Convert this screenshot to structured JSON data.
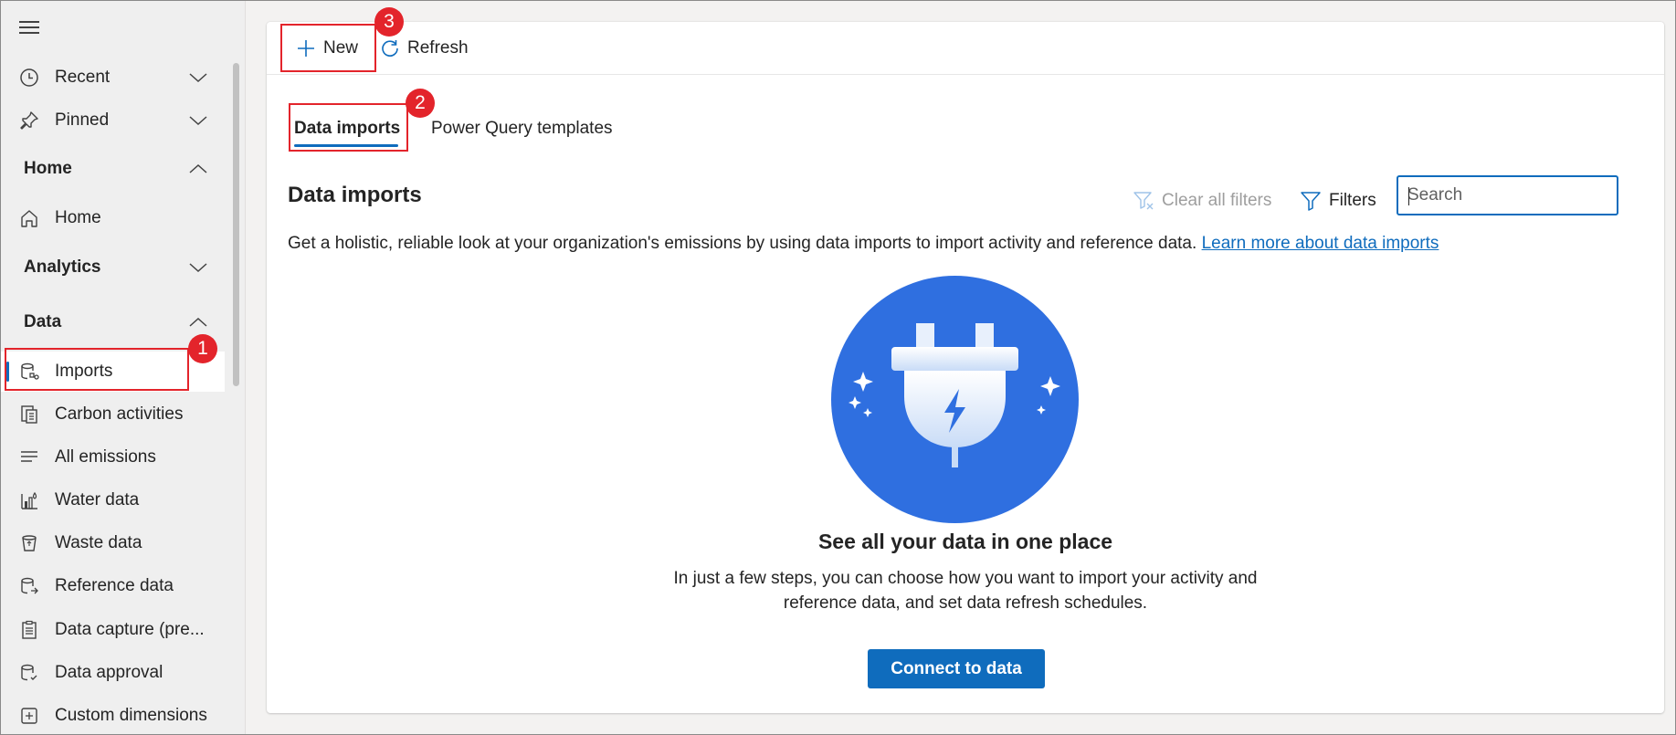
{
  "sidebar": {
    "items": [
      {
        "label": "Recent",
        "icon": "clock-icon"
      },
      {
        "label": "Pinned",
        "icon": "pin-icon"
      }
    ],
    "sections": [
      {
        "label": "Home",
        "expanded": true
      },
      {
        "label": "Analytics",
        "expanded": false
      },
      {
        "label": "Data",
        "expanded": true
      }
    ],
    "home_items": [
      {
        "label": "Home",
        "icon": "home-icon"
      }
    ],
    "data_items": [
      {
        "label": "Imports",
        "icon": "database-import-icon",
        "active": true
      },
      {
        "label": "Carbon activities",
        "icon": "document-list-icon"
      },
      {
        "label": "All emissions",
        "icon": "text-lines-icon"
      },
      {
        "label": "Water data",
        "icon": "water-chart-icon"
      },
      {
        "label": "Waste data",
        "icon": "recycle-bin-icon"
      },
      {
        "label": "Reference data",
        "icon": "database-arrow-icon"
      },
      {
        "label": "Data capture (pre...",
        "icon": "clipboard-icon"
      },
      {
        "label": "Data approval",
        "icon": "database-check-icon"
      },
      {
        "label": "Custom dimensions",
        "icon": "cube-icon"
      }
    ]
  },
  "commandbar": {
    "new_label": "New",
    "refresh_label": "Refresh"
  },
  "tabs": [
    {
      "label": "Data imports",
      "active": true
    },
    {
      "label": "Power Query templates",
      "active": false
    }
  ],
  "main": {
    "title": "Data imports",
    "clear_filters_label": "Clear all filters",
    "filters_label": "Filters",
    "search_placeholder": "Search",
    "description": "Get a holistic, reliable look at your organization's emissions by using data imports to import activity and reference data.",
    "learn_more_link": "Learn more about data imports",
    "empty_state": {
      "title": "See all your data in one place",
      "description": "In just a few steps, you can choose how you want to import your activity and reference data, and set data refresh schedules.",
      "button_label": "Connect to data"
    }
  },
  "annotations": [
    "1",
    "2",
    "3"
  ],
  "colors": {
    "accent": "#0f6cbd",
    "callout": "#e3242b",
    "illustration_bg": "#2f6fe0"
  }
}
